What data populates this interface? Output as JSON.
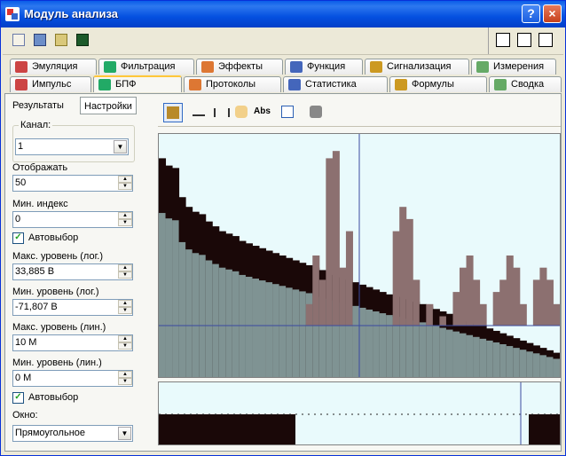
{
  "window": {
    "title": "Модуль анализа"
  },
  "title_buttons": {
    "help": "?",
    "minimize": "_",
    "close": "×"
  },
  "tabs_row1": [
    {
      "label": "Эмуляция",
      "icon": "wave-icon"
    },
    {
      "label": "Фильтрация",
      "icon": "filter-icon"
    },
    {
      "label": "Эффекты",
      "icon": "effects-icon"
    },
    {
      "label": "Функция",
      "icon": "function-icon"
    },
    {
      "label": "Сигнализация",
      "icon": "alarm-icon"
    },
    {
      "label": "Измерения",
      "icon": "meter-icon"
    }
  ],
  "tabs_row2": [
    {
      "label": "Импульс",
      "icon": "pulse-icon"
    },
    {
      "label": "БПФ",
      "icon": "fft-icon",
      "active": true
    },
    {
      "label": "Протоколы",
      "icon": "protocol-icon"
    },
    {
      "label": "Статистика",
      "icon": "stats-icon"
    },
    {
      "label": "Формулы",
      "icon": "formula-icon"
    },
    {
      "label": "Сводка",
      "icon": "summary-icon"
    }
  ],
  "left_tabs": {
    "results": "Результаты",
    "settings": "Настройки"
  },
  "settings": {
    "channel_label": "Канал:",
    "channel_value": "1",
    "display_label": "Отображать",
    "display_value": "50",
    "min_index_label": "Мин. индекс",
    "min_index_value": "0",
    "autoselect1": "Автовыбор",
    "max_log_label": "Макс. уровень (лог.)",
    "max_log_value": "33,885 В",
    "min_log_label": "Мин. уровень (лог.)",
    "min_log_value": "-71,807 В",
    "max_lin_label": "Макс. уровень (лин.)",
    "max_lin_value": "10 M",
    "min_lin_label": "Мин. уровень (лин.)",
    "min_lin_value": "0 M",
    "autoselect2": "Автовыбор",
    "window_label": "Окно:",
    "window_value": "Прямоугольное"
  },
  "plot_toolbar": {
    "abs_label": "Abs"
  },
  "colors": {
    "bg": "#e9fafc",
    "dark": "#1a0808",
    "mauve": "#8c7070",
    "gray": "#7f9393"
  },
  "chart_data": {
    "type": "bar",
    "series": [
      {
        "values": [
          0.9,
          0.87,
          0.86,
          0.74,
          0.7,
          0.68,
          0.67,
          0.64,
          0.62,
          0.6,
          0.59,
          0.58,
          0.56,
          0.55,
          0.54,
          0.53,
          0.52,
          0.51,
          0.5,
          0.49,
          0.48,
          0.47,
          0.46,
          0.45,
          0.44,
          0.43,
          0.42,
          0.41,
          0.4,
          0.39,
          0.38,
          0.37,
          0.36,
          0.35,
          0.34,
          0.33,
          0.33,
          0.32,
          0.31,
          0.3,
          0.29,
          0.28,
          0.27,
          0.26,
          0.25,
          0.24,
          0.23,
          0.22,
          0.21,
          0.2,
          0.19,
          0.18,
          0.17,
          0.16,
          0.15,
          0.14,
          0.13,
          0.12,
          0.11,
          0.1
        ]
      },
      {
        "values": [
          0.0,
          0.0,
          0.0,
          0.0,
          0.0,
          0.0,
          0.0,
          0.0,
          0.0,
          0.0,
          0.0,
          0.0,
          0.0,
          0.0,
          0.0,
          0.0,
          0.0,
          0.0,
          0.0,
          0.0,
          0.0,
          0.0,
          0.3,
          0.5,
          0.4,
          0.9,
          0.93,
          0.45,
          0.6,
          0.2,
          0.15,
          0.1,
          0.2,
          0.1,
          0.2,
          0.6,
          0.7,
          0.65,
          0.4,
          0.2,
          0.3,
          0.1,
          0.25,
          0.2,
          0.35,
          0.45,
          0.5,
          0.4,
          0.3,
          0.2,
          0.35,
          0.4,
          0.5,
          0.45,
          0.3,
          0.2,
          0.4,
          0.45,
          0.4,
          0.3
        ]
      }
    ]
  }
}
